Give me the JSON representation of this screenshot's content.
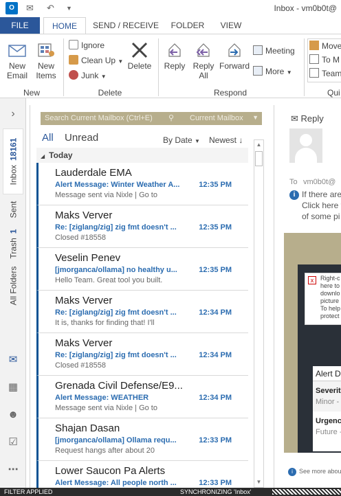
{
  "window": {
    "title": "Inbox - vm0b0t@",
    "app_icon_text": "O"
  },
  "ribbon_tabs": {
    "file": "FILE",
    "home": "HOME",
    "send_receive": "SEND / RECEIVE",
    "folder": "FOLDER",
    "view": "VIEW"
  },
  "ribbon": {
    "new_email": "New Email",
    "new_items": "New Items",
    "group_new": "New",
    "ignore": "Ignore",
    "clean_up": "Clean Up",
    "junk": "Junk",
    "delete": "Delete",
    "group_delete": "Delete",
    "reply": "Reply",
    "reply_all": "Reply All",
    "forward": "Forward",
    "meeting": "Meeting",
    "more": "More",
    "group_respond": "Respond",
    "move_to": "Move",
    "to_manager": "To M",
    "team": "Team",
    "group_quick": "Qui"
  },
  "nav": {
    "inbox_label": "Inbox",
    "inbox_count": "18161",
    "sent_label": "Sent",
    "trash_label": "Trash",
    "trash_count": "1",
    "all_folders_label": "All Folders",
    "expand_glyph": "›"
  },
  "search": {
    "placeholder": "Search Current Mailbox (Ctrl+E)",
    "scope": "Current Mailbox"
  },
  "filters": {
    "all": "All",
    "unread": "Unread",
    "sort_by": "By Date",
    "order": "Newest"
  },
  "group_today": "Today",
  "messages": [
    {
      "sender": "Lauderdale EMA",
      "subject": "Alert Message: Winter Weather A...",
      "time": "12:35 PM",
      "preview": "Message sent via Nixle | Go to"
    },
    {
      "sender": "Maks Verver",
      "subject": "Re: [ziglang/zig] zig fmt doesn't ...",
      "time": "12:35 PM",
      "preview": "Closed #18558"
    },
    {
      "sender": "Veselin Penev",
      "subject": "[jmorganca/ollama] no healthy u...",
      "time": "12:35 PM",
      "preview": "Hello Team.  Great tool you built."
    },
    {
      "sender": "Maks Verver",
      "subject": "Re: [ziglang/zig] zig fmt doesn't ...",
      "time": "12:34 PM",
      "preview": "It is, thanks for finding that! I'll"
    },
    {
      "sender": "Maks Verver",
      "subject": "Re: [ziglang/zig] zig fmt doesn't ...",
      "time": "12:34 PM",
      "preview": "Closed #18558"
    },
    {
      "sender": "Grenada Civil Defense/E9...",
      "subject": "Alert Message: WEATHER",
      "time": "12:34 PM",
      "preview": "Message sent via Nixle | Go to"
    },
    {
      "sender": "Shajan Dasan",
      "subject": "[jmorganca/ollama] Ollama requ...",
      "time": "12:33 PM",
      "preview": "Request hangs after about 20"
    },
    {
      "sender": "Lower Saucon Pa Alerts",
      "subject": "Alert Message: All people north ...",
      "time": "12:33 PM",
      "preview": ""
    }
  ],
  "reading": {
    "reply": "Reply",
    "to_label": "To",
    "to_value": "vm0b0t@",
    "info_line1": "If there are",
    "info_line2": "Click here t",
    "info_line3": "of some pi",
    "img_text_1": "Right-c",
    "img_text_2": "here to",
    "img_text_3": "downlo",
    "img_text_4": "picture",
    "img_text_5": "To help",
    "img_text_6": "protect",
    "alert_header": "Alert Dev",
    "severity_label": "Severit",
    "severity_value": "Minor -",
    "urgency_label": "Urgenc",
    "urgency_value": "Future -",
    "see_more": "See more abou"
  },
  "status": {
    "filter": "FILTER APPLIED",
    "sync": "SYNCHRONIZING  'Inbox'"
  },
  "colors": {
    "accent": "#2b579a",
    "subject_blue": "#2b6cb0",
    "search_bg": "#b7ae8c"
  }
}
